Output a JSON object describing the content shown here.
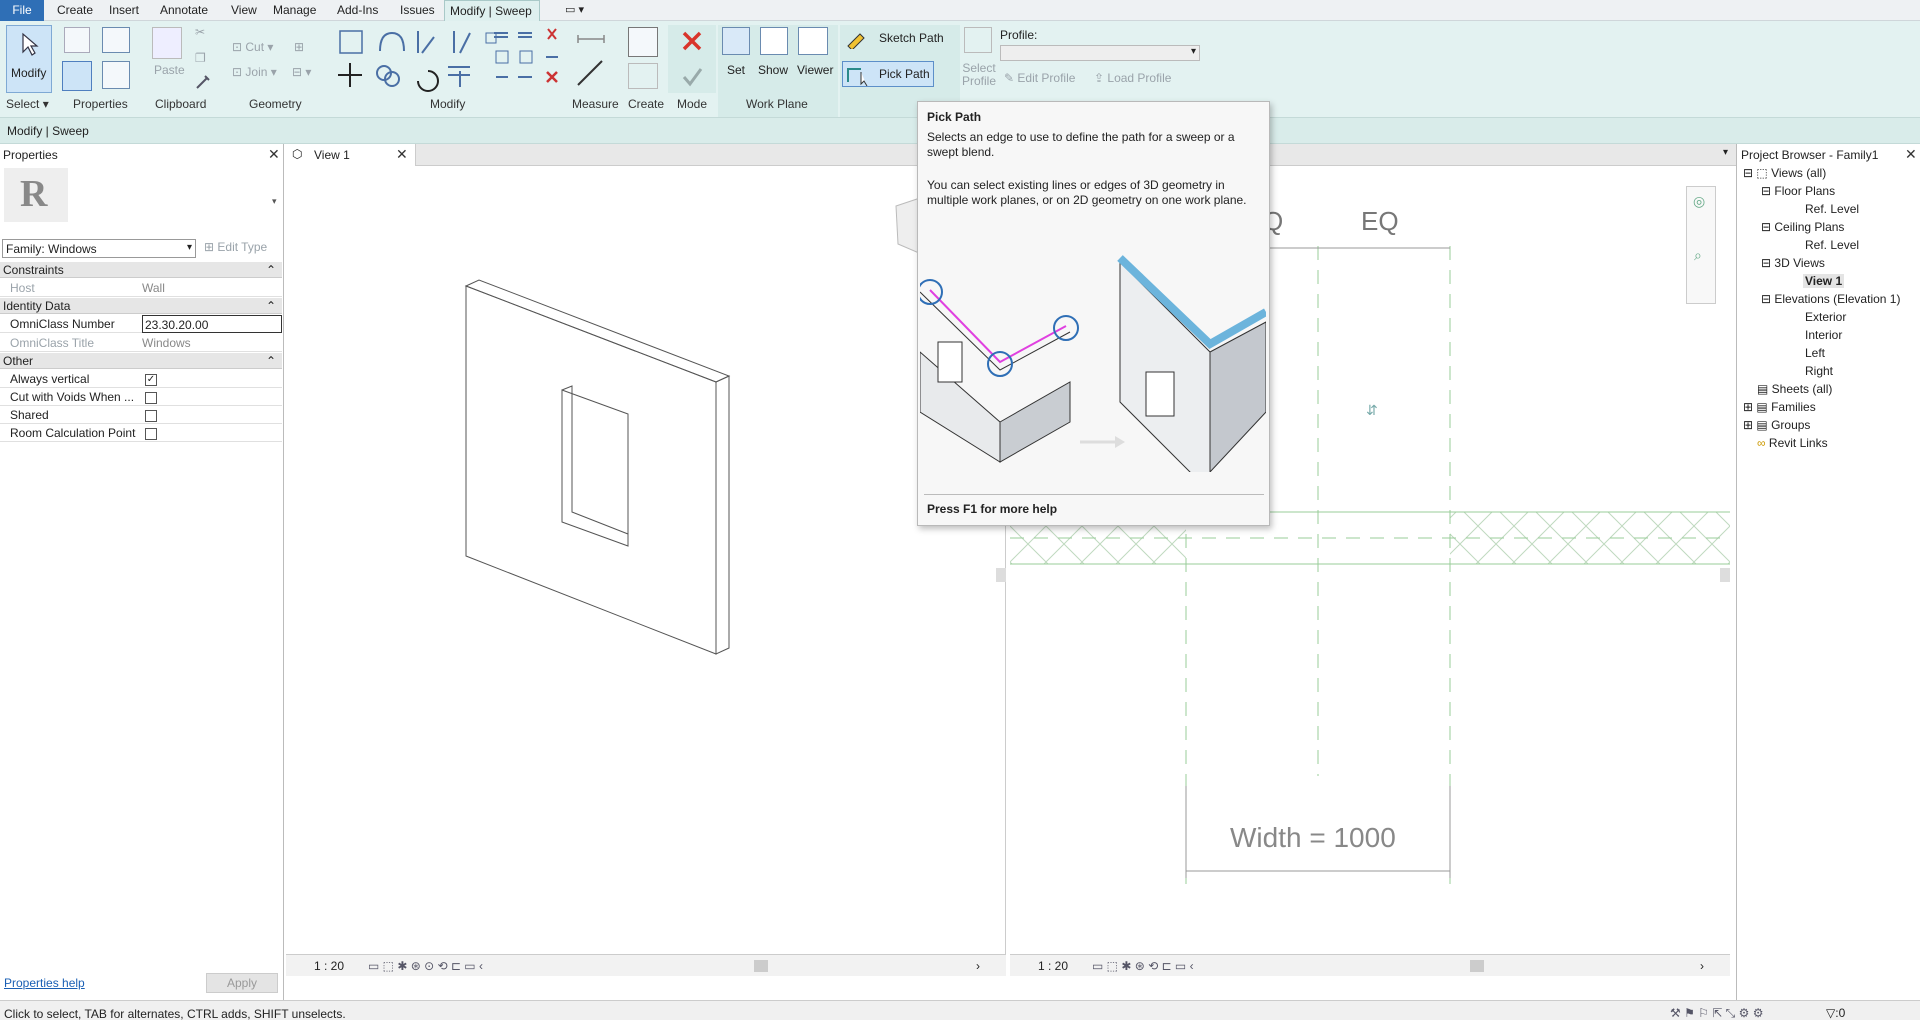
{
  "menu": {
    "tabs": [
      "File",
      "Create",
      "Insert",
      "Annotate",
      "View",
      "Manage",
      "Add-Ins",
      "Issues",
      "Modify | Sweep"
    ],
    "extra": "▭ ▾"
  },
  "ribbon": {
    "modify_label": "Modify",
    "paste_label": "Paste",
    "cut_label": "Cut",
    "join_label": "Join",
    "set_label": "Set",
    "show_label": "Show",
    "viewer_label": "Viewer",
    "sketch_path_label": "Sketch Path",
    "pick_path_label": "Pick Path",
    "select_profile_label": "Select\nProfile",
    "profile_label": "Profile:",
    "edit_profile_label": "Edit Profile",
    "load_profile_label": "Load Profile",
    "panels": {
      "select": "Select",
      "properties": "Properties",
      "clipboard": "Clipboard",
      "geometry": "Geometry",
      "modify": "Modify",
      "measure": "Measure",
      "create": "Create",
      "mode": "Mode",
      "work_plane": "Work Plane"
    }
  },
  "context_bar": "Modify | Sweep",
  "properties": {
    "title": "Properties",
    "family_selector": "Family: Windows",
    "edit_type": "Edit Type",
    "sections": {
      "constraints": "Constraints",
      "identity": "Identity Data",
      "other": "Other"
    },
    "rows": {
      "host_k": "Host",
      "host_v": "Wall",
      "omni_num_k": "OmniClass Number",
      "omni_num_v": "23.30.20.00",
      "omni_title_k": "OmniClass Title",
      "omni_title_v": "Windows",
      "always_vertical": "Always vertical",
      "cut_voids": "Cut with Voids When ...",
      "shared": "Shared",
      "room_calc": "Room Calculation Point"
    },
    "help_link": "Properties help",
    "apply": "Apply"
  },
  "view_tab": "View 1",
  "view1_scale": "1 : 20",
  "view2_scale": "1 : 20",
  "view2": {
    "eq_label": "EQ",
    "eq_label_partial": "Q",
    "width_label": "Width = 1000"
  },
  "tooltip": {
    "title": "Pick Path",
    "desc1": "Selects an edge to use to define the path for a sweep or a swept blend.",
    "desc2": "You can select existing lines or edges of 3D geometry in multiple work planes, or on 2D geometry on one work plane.",
    "footer": "Press F1 for more help"
  },
  "project_browser": {
    "title": "Project Browser - Family1",
    "items": {
      "views_all": "Views (all)",
      "floor_plans": "Floor Plans",
      "ref_level_1": "Ref. Level",
      "ceiling_plans": "Ceiling Plans",
      "ref_level_2": "Ref. Level",
      "views_3d": "3D Views",
      "view1": "View 1",
      "elevations": "Elevations (Elevation 1)",
      "exterior": "Exterior",
      "interior": "Interior",
      "left": "Left",
      "right": "Right",
      "sheets": "Sheets (all)",
      "families": "Families",
      "groups": "Groups",
      "revit_links": "Revit Links"
    }
  },
  "status": {
    "text": "Click to select, TAB for alternates, CTRL adds, SHIFT unselects.",
    "filter_count": ":0"
  },
  "colors": {
    "ribbon_bg": "#e3f2f1",
    "file_tab": "#2f6fb6",
    "red_x": "#d9342b",
    "magenta_path": "#e040e0",
    "teal_sweep": "#6cb4dc"
  }
}
